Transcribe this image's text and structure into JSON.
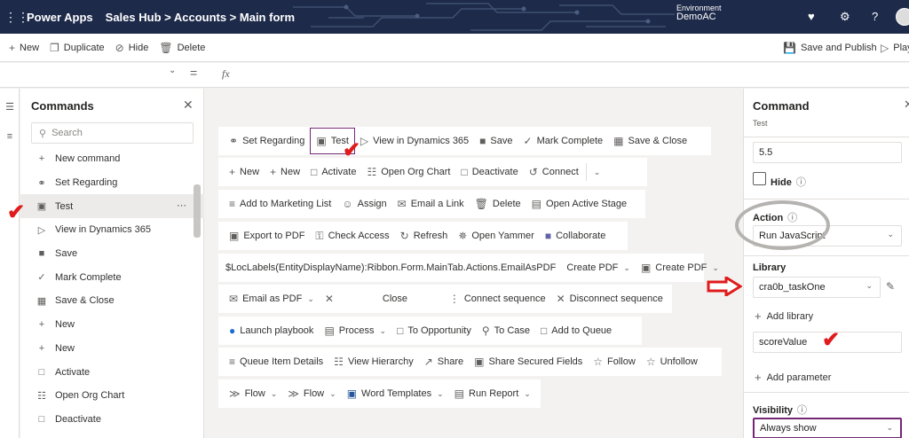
{
  "header": {
    "app_name": "Power Apps",
    "breadcrumb": "Sales Hub > Accounts > Main form",
    "env_label": "Environment",
    "env_name": "DemoAC",
    "icons": [
      "waffle-icon",
      "bell-icon",
      "gear-icon",
      "help-icon",
      "avatar"
    ]
  },
  "toolbar": {
    "new": "New",
    "duplicate": "Duplicate",
    "hide": "Hide",
    "delete": "Delete",
    "save_publish": "Save and Publish",
    "play": "Play"
  },
  "formula": {
    "fx": "fx"
  },
  "commands_panel": {
    "title": "Commands",
    "search_placeholder": "Search",
    "items": [
      {
        "label": "New command",
        "icon": "plus-icon"
      },
      {
        "label": "Set Regarding",
        "icon": "link-icon"
      },
      {
        "label": "Test",
        "icon": "office-icon",
        "selected": true
      },
      {
        "label": "View in Dynamics 365",
        "icon": "play-icon"
      },
      {
        "label": "Save",
        "icon": "save-icon"
      },
      {
        "label": "Mark Complete",
        "icon": "check-icon"
      },
      {
        "label": "Save & Close",
        "icon": "save-close-icon"
      },
      {
        "label": "New",
        "icon": "plus-icon"
      },
      {
        "label": "New",
        "icon": "plus-icon"
      },
      {
        "label": "Activate",
        "icon": "document-icon"
      },
      {
        "label": "Open Org Chart",
        "icon": "org-chart-icon"
      },
      {
        "label": "Deactivate",
        "icon": "document-icon"
      }
    ]
  },
  "canvas": {
    "rows": [
      [
        "Set Regarding",
        "Test",
        "View in Dynamics 365",
        "Save",
        "Mark Complete",
        "Save & Close"
      ],
      [
        "New",
        "New",
        "Activate",
        "Open Org Chart",
        "Deactivate",
        "Connect"
      ],
      [
        "Add to Marketing List",
        "Assign",
        "Email a Link",
        "Delete",
        "Open Active Stage"
      ],
      [
        "Export to PDF",
        "Check Access",
        "Refresh",
        "Open Yammer",
        "Collaborate"
      ],
      [
        "$LocLabels(EntityDisplayName):Ribbon.Form.MainTab.Actions.EmailAsPDF",
        "Create PDF",
        "Create PDF"
      ],
      [
        "Email as PDF",
        "Close",
        "Connect sequence",
        "Disconnect sequence"
      ],
      [
        "Launch playbook",
        "Process",
        "To Opportunity",
        "To Case",
        "Add to Queue"
      ],
      [
        "Queue Item Details",
        "View Hierarchy",
        "Share",
        "Share Secured Fields",
        "Follow",
        "Unfollow"
      ],
      [
        "Flow",
        "Flow",
        "Word Templates",
        "Run Report"
      ]
    ]
  },
  "properties": {
    "title": "Command",
    "subtitle": "Test",
    "version_value": "5.5",
    "hide_label": "Hide",
    "action_label": "Action",
    "action_value": "Run JavaScript",
    "library_label": "Library",
    "library_value": "cra0b_taskOne",
    "add_library": "Add library",
    "function_value": "scoreValue",
    "add_parameter": "Add parameter",
    "visibility_label": "Visibility",
    "visibility_value": "Always show"
  }
}
